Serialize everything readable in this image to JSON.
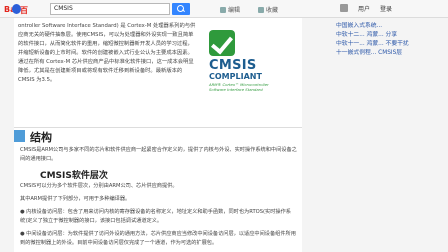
{
  "topbar": {
    "logo_bai": "Bai",
    "logo_du": "百",
    "search_value": "CMSIS",
    "link1": "编辑",
    "link2": "收藏",
    "user_name": "用户",
    "login": "登录"
  },
  "article": {
    "top_para": "ontroller Software Interface Standard) 是 Cortex-M 处理器系列的与供应商无关的硬件抽象层。使用CMSIS，可以为处理器和外设实现一致且简单的软件接口，从而简化软件的重用，缩短微控制器新开发人员的学习过程，并缩短新设备的上市时间。软件的创建被嵌入式行业公认为主要成本因素。通过在所有 Cortex-M 芯片供应商产品中标准化软件接口，这一成本会明显降低，尤其是在创建新项目或将现有软件迁移到新设备时。最新版本的CMSIS 为3.5。",
    "logo": {
      "word": "CMSIS",
      "compliant": "COMPLIANT",
      "tag1": "ARM® Cortex™ Microcontroller",
      "tag2": "Software Interface Standard"
    },
    "section_title": "结构",
    "intro": "CMSIS是ARM公司与多家不同的芯片和软件供应商一起紧密合作定义的，提供了内核与外设、实时操作系统和中间设备之间的通用接口。",
    "sub_title": "CMSIS软件层次",
    "lines": [
      "CMSIS可以分为多个软件层次，分别由ARM公司、芯片供应商提供。",
      "其中ARM提供了下列部分，可用于多种编译器。",
      "● 内核设备访问层：包含了用来访问内核的寄存器设备的名称定义，地址定义和助手函数，同时也为RTOS(实时操作系统)定义了独立于微控制器的接口，该接口包括调试通道定义。",
      "● 中间设备访问层：为软件提供了访问外设的通用方法，芯片供应商应当修改中间设备访问层，以适应中间设备组件所用到的微控制器上的外设。目前中间设备访问层仅完成了一个通道，作为可选的扩展包。"
    ]
  },
  "sidebar": {
    "items": [
      "中国嵌入式系统...",
      "中软十二... 鸿蒙... 分享",
      "中软十一... 鸿蒙... 不要干扰",
      "十一嵌式例程... CMSIS层"
    ]
  }
}
